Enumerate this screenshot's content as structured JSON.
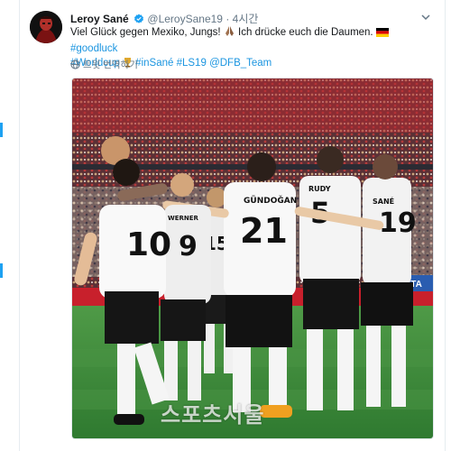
{
  "tweet": {
    "author_name": "Leroy Sané",
    "handle": "@LeroySane19",
    "separator": "·",
    "time": "4시간",
    "text_part1": "Viel Glück gegen Mexiko, Jungs!",
    "text_part2": "Ich drücke euch die Daumen.",
    "hashtag_goodluck": "#goodluck",
    "hashtag_worldcup": "#Worldcup",
    "hashtag_insane": "#inSané",
    "hashtag_ls19": "#LS19",
    "mention_dfb": "@DFB_Team",
    "translate_label": "트윗 번역하기"
  },
  "photo": {
    "jersey_names": [
      "GÜNDOĞAN",
      "WERNER",
      "SANÉ",
      "RUDY"
    ],
    "jersey_numbers": [
      "21",
      "9",
      "10",
      "15",
      "5",
      "19"
    ],
    "ad_board_text": "RTA",
    "watermark": "스포츠서울"
  },
  "colors": {
    "link": "#1b95e0",
    "muted": "#657786",
    "verified": "#1da1f2",
    "pitch": "#3f8a3a",
    "stands_red": "#b42a32"
  },
  "icons": [
    "verified-badge-icon",
    "praying-hands-emoji",
    "germany-flag-emoji",
    "trophy-emoji",
    "globe-icon",
    "chevron-down-icon"
  ]
}
